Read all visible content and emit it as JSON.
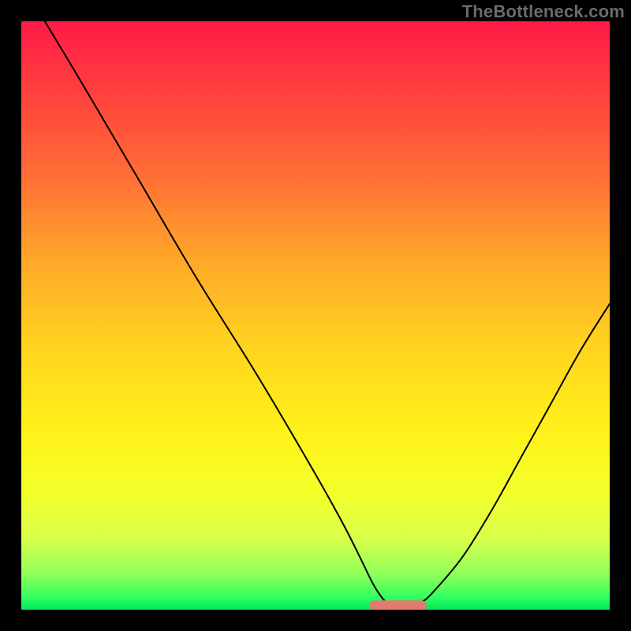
{
  "watermark": "TheBottleneck.com",
  "chart_data": {
    "type": "line",
    "title": "",
    "xlabel": "",
    "ylabel": "",
    "xlim": [
      0,
      100
    ],
    "ylim": [
      0,
      100
    ],
    "series": [
      {
        "name": "bottleneck-curve",
        "x": [
          4,
          10,
          20,
          30,
          40,
          50,
          55,
          58,
          60,
          62,
          64,
          66,
          68,
          70,
          75,
          80,
          85,
          90,
          95,
          100
        ],
        "y": [
          100,
          90,
          73,
          56,
          40,
          23,
          14,
          8,
          4,
          1.3,
          0.7,
          0.7,
          1.3,
          3,
          9,
          17,
          26,
          35,
          44,
          52
        ]
      },
      {
        "name": "optimal-zone-marker",
        "x": [
          60,
          68
        ],
        "y": [
          0.7,
          0.7
        ]
      }
    ],
    "gradient_stops": [
      {
        "pos": 0,
        "color": "#ff1a47"
      },
      {
        "pos": 25,
        "color": "#ff6a36"
      },
      {
        "pos": 55,
        "color": "#ffd31f"
      },
      {
        "pos": 80,
        "color": "#f4ff2a"
      },
      {
        "pos": 100,
        "color": "#00e85c"
      }
    ]
  }
}
